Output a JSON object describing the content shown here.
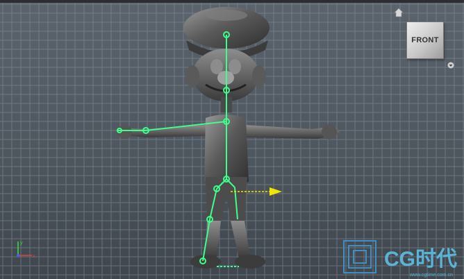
{
  "viewport": {
    "view_label": "FRONT",
    "view": "front orthographic",
    "background_color": "#545c64",
    "grid_color": "#8a939c"
  },
  "viewcube": {
    "face_label": "FRONT",
    "home_icon": "home-icon",
    "menu_icon": "triangle-down-icon"
  },
  "skeleton": {
    "joint_color": "#3dff8c"
  },
  "gizmo": {
    "x_axis_color": "#e04040",
    "y_axis_color": "#40e040",
    "z_axis_color": "#4060ff"
  },
  "manipulator": {
    "arrow_color": "#f2e600"
  },
  "watermark": {
    "brand": "CG时代",
    "url": "www.cgtime.com.cn"
  }
}
